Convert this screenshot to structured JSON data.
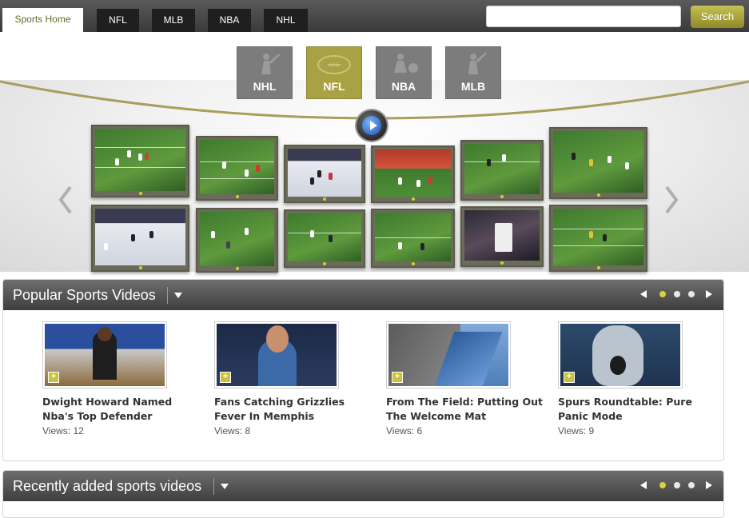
{
  "nav": {
    "tabs": [
      {
        "label": "Sports Home",
        "active": true
      },
      {
        "label": "NFL",
        "active": false
      },
      {
        "label": "MLB",
        "active": false
      },
      {
        "label": "NBA",
        "active": false
      },
      {
        "label": "NHL",
        "active": false
      }
    ],
    "search": {
      "value": "",
      "placeholder": "",
      "button_label": "Search"
    }
  },
  "hero": {
    "sports": [
      {
        "label": "NHL",
        "icon": "golfer-icon",
        "active": false
      },
      {
        "label": "NFL",
        "icon": "football-icon",
        "active": true
      },
      {
        "label": "NBA",
        "icon": "basketball-player-icon",
        "active": false
      },
      {
        "label": "MLB",
        "icon": "baseball-batter-icon",
        "active": false
      }
    ],
    "play_icon": "play-icon",
    "prev_icon": "chevron-left-icon",
    "next_icon": "chevron-right-icon",
    "accent_color": "#a9a244"
  },
  "popular": {
    "title": "Popular Sports Videos",
    "page_count": 3,
    "current_page": 1,
    "videos": [
      {
        "title": "Dwight Howard Named Nba's Top Defender",
        "views": "Views: 12"
      },
      {
        "title": "Fans Catching Grizzlies Fever In Memphis",
        "views": "Views: 8"
      },
      {
        "title": "From The Field: Putting Out The Welcome Mat",
        "views": "Views: 6"
      },
      {
        "title": "Spurs Roundtable: Pure Panic Mode",
        "views": "Views: 9"
      }
    ]
  },
  "recent": {
    "title": "Recently added sports videos",
    "page_count": 3,
    "current_page": 1
  }
}
